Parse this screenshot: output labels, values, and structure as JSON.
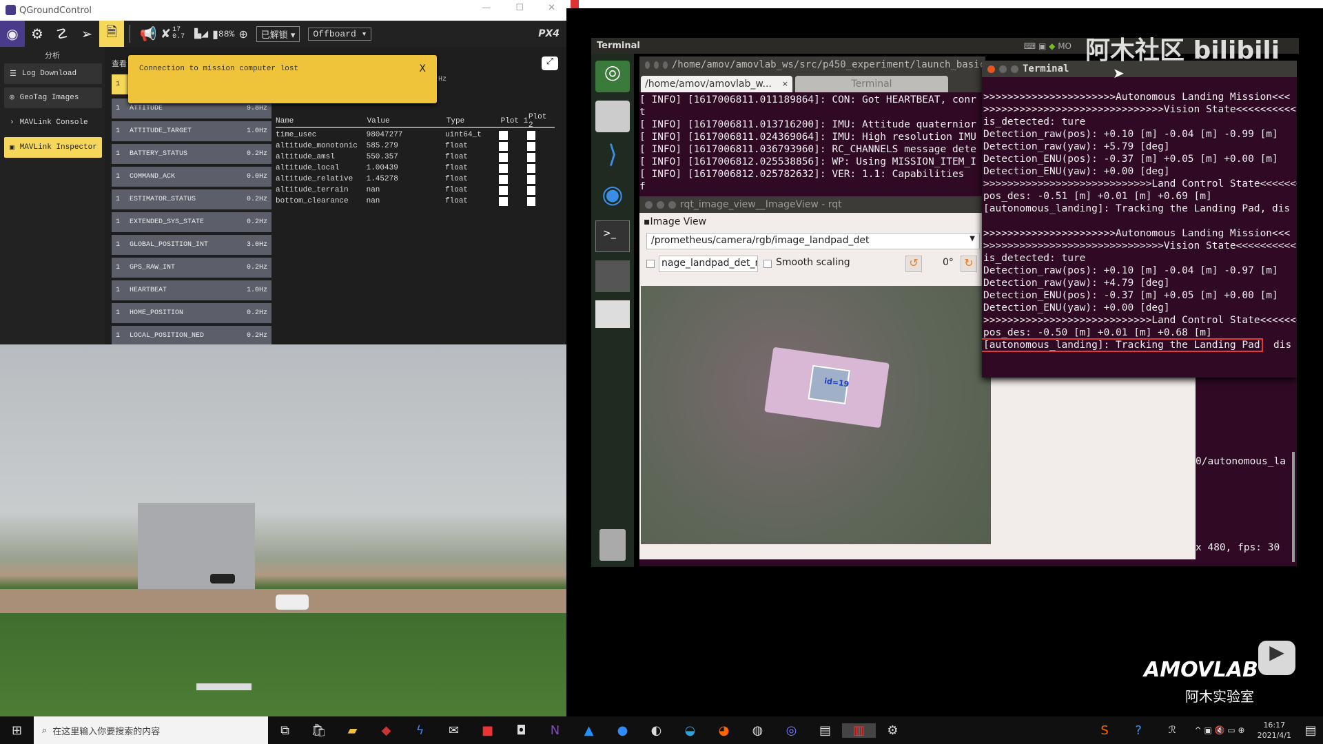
{
  "qgc": {
    "title": "QGroundControl",
    "toolbar": {
      "satellites": "17",
      "hdop": "0.7",
      "battery": "88%",
      "arm_state": "已解锁",
      "flight_mode": "Offboard",
      "logo": "PX4"
    },
    "sidebar": {
      "header": "分析",
      "items": [
        {
          "label": "Log Download"
        },
        {
          "label": "GeoTag Images"
        },
        {
          "label": "MAVLink Console"
        },
        {
          "label": "MAVLink Inspector",
          "active": true
        }
      ]
    },
    "inspector": {
      "view_label": "查看",
      "selected_row": "1",
      "hz_fragment": "Hz",
      "toast": {
        "text": "Connection to mission computer lost",
        "close": "X"
      },
      "messages": [
        {
          "id": "1",
          "name": "ATTITUDE",
          "rate": "9.8Hz"
        },
        {
          "id": "1",
          "name": "ATTITUDE_TARGET",
          "rate": "1.0Hz"
        },
        {
          "id": "1",
          "name": "BATTERY_STATUS",
          "rate": "0.2Hz"
        },
        {
          "id": "1",
          "name": "COMMAND_ACK",
          "rate": "0.0Hz"
        },
        {
          "id": "1",
          "name": "ESTIMATOR_STATUS",
          "rate": "0.2Hz"
        },
        {
          "id": "1",
          "name": "EXTENDED_SYS_STATE",
          "rate": "0.2Hz"
        },
        {
          "id": "1",
          "name": "GLOBAL_POSITION_INT",
          "rate": "3.0Hz"
        },
        {
          "id": "1",
          "name": "GPS_RAW_INT",
          "rate": "0.2Hz"
        },
        {
          "id": "1",
          "name": "HEARTBEAT",
          "rate": "1.0Hz"
        },
        {
          "id": "1",
          "name": "HOME_POSITION",
          "rate": "0.2Hz"
        },
        {
          "id": "1",
          "name": "LOCAL_POSITION_NED",
          "rate": "0.2Hz"
        }
      ],
      "columns": [
        "Name",
        "Value",
        "Type",
        "Plot 1",
        "Plot 2"
      ],
      "fields": [
        {
          "name": "time_usec",
          "value": "98047277",
          "type": "uint64_t"
        },
        {
          "name": "altitude_monotonic",
          "value": "585.279",
          "type": "float"
        },
        {
          "name": "altitude_amsl",
          "value": "550.357",
          "type": "float"
        },
        {
          "name": "altitude_local",
          "value": "1.00439",
          "type": "float"
        },
        {
          "name": "altitude_relative",
          "value": "1.45278",
          "type": "float"
        },
        {
          "name": "altitude_terrain",
          "value": "nan",
          "type": "float"
        },
        {
          "name": "bottom_clearance",
          "value": "nan",
          "type": "float"
        }
      ]
    }
  },
  "ubuntu": {
    "panel_title": "Terminal",
    "panel_indicator": "MO",
    "terminal1": {
      "title": "/home/amov/amovlab_ws/src/p450_experiment/launch_basic",
      "tabs": [
        "/home/amov/amovlab_w...",
        "Terminal"
      ],
      "lines": [
        "[ INFO] [1617006811.011189864]: CON: Got HEARTBEAT, conr",
        "t",
        "[ INFO] [1617006811.013716200]: IMU: Attitude quaternior",
        "[ INFO] [1617006811.024369064]: IMU: High resolution IMU",
        "[ INFO] [1617006811.036793960]: RC_CHANNELS message dete",
        "[ INFO] [1617006812.025538856]: WP: Using MISSION_ITEM_I",
        "[ INFO] [1617006812.025782632]: VER: 1.1: Capabilities",
        "f"
      ],
      "lower_lines": [
        "0/autonomous_la",
        "x 480, fps: 30"
      ]
    },
    "rqt": {
      "title": "rqt_image_view__ImageView - rqt",
      "panel_label": "Image View",
      "topic": "/prometheus/camera/rgb/image_landpad_det",
      "mouse_topic": "nage_landpad_det_mouse_left",
      "smooth_label": "Smooth scaling",
      "rotation": "0°",
      "marker_label": "id=19"
    },
    "terminal2": {
      "title": "Terminal",
      "lines": [
        ">>>>>>>>>>>>>>>>>>>>>>Autonomous Landing Mission<<<",
        ">>>>>>>>>>>>>>>>>>>>>>>>>>>>>>Vision State<<<<<<<<<<",
        "is_detected: ture",
        "Detection_raw(pos): +0.10 [m] -0.04 [m] -0.99 [m]",
        "Detection_raw(yaw): +5.79 [deg]",
        "Detection_ENU(pos): -0.37 [m] +0.05 [m] +0.00 [m]",
        "Detection_ENU(yaw): +0.00 [deg]",
        ">>>>>>>>>>>>>>>>>>>>>>>>>>>>Land Control State<<<<<<<",
        "pos_des: -0.51 [m] +0.01 [m] +0.69 [m]",
        "[autonomous_landing]: Tracking the Landing Pad, dis",
        "",
        ">>>>>>>>>>>>>>>>>>>>>>Autonomous Landing Mission<<<",
        ">>>>>>>>>>>>>>>>>>>>>>>>>>>>>>Vision State<<<<<<<<<<",
        "is_detected: ture",
        "Detection_raw(pos): +0.10 [m] -0.04 [m] -0.97 [m]",
        "Detection_raw(yaw): +4.79 [deg]",
        "Detection_ENU(pos): -0.37 [m] +0.05 [m] +0.00 [m]",
        "Detection_ENU(yaw): +0.00 [deg]",
        ">>>>>>>>>>>>>>>>>>>>>>>>>>>>Land Control State<<<<<<<",
        "pos_des: -0.50 [m] +0.01 [m] +0.68 [m]"
      ],
      "highlighted": "[autonomous_landing]: Tracking the Landing Pad",
      "highlighted_tail": "  dis",
      "highlight_color": "#e53935"
    }
  },
  "watermarks": {
    "top": "阿木社区 bilibili",
    "bottom": "AMOVLAB",
    "bottom_sub": "阿木实验室"
  },
  "taskbar": {
    "search_placeholder": "在这里输入你要搜索的内容",
    "time": "16:17",
    "date": "2021/4/1"
  },
  "colors": {
    "toast": "#f0c43a",
    "active_side": "#f5d75a",
    "terminal_bg": "#300a24"
  }
}
